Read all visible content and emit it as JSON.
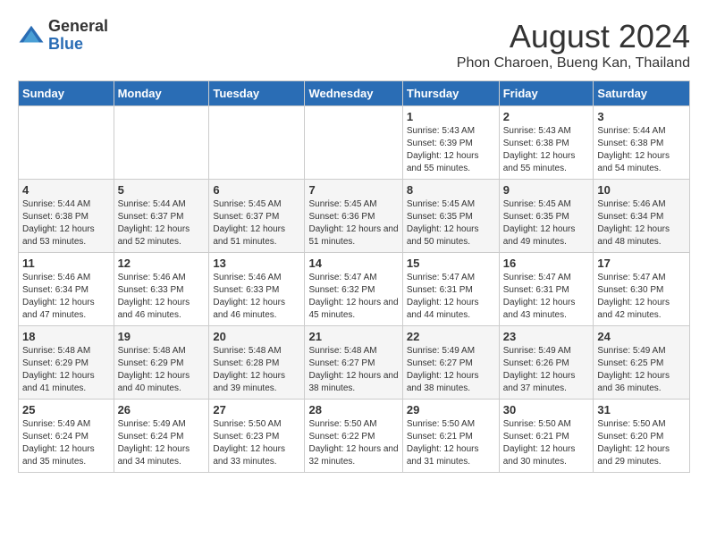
{
  "logo": {
    "general": "General",
    "blue": "Blue"
  },
  "header": {
    "month": "August 2024",
    "location": "Phon Charoen, Bueng Kan, Thailand"
  },
  "days_of_week": [
    "Sunday",
    "Monday",
    "Tuesday",
    "Wednesday",
    "Thursday",
    "Friday",
    "Saturday"
  ],
  "weeks": [
    [
      {
        "day": "",
        "info": ""
      },
      {
        "day": "",
        "info": ""
      },
      {
        "day": "",
        "info": ""
      },
      {
        "day": "",
        "info": ""
      },
      {
        "day": "1",
        "info": "Sunrise: 5:43 AM\nSunset: 6:39 PM\nDaylight: 12 hours and 55 minutes."
      },
      {
        "day": "2",
        "info": "Sunrise: 5:43 AM\nSunset: 6:38 PM\nDaylight: 12 hours and 55 minutes."
      },
      {
        "day": "3",
        "info": "Sunrise: 5:44 AM\nSunset: 6:38 PM\nDaylight: 12 hours and 54 minutes."
      }
    ],
    [
      {
        "day": "4",
        "info": "Sunrise: 5:44 AM\nSunset: 6:38 PM\nDaylight: 12 hours and 53 minutes."
      },
      {
        "day": "5",
        "info": "Sunrise: 5:44 AM\nSunset: 6:37 PM\nDaylight: 12 hours and 52 minutes."
      },
      {
        "day": "6",
        "info": "Sunrise: 5:45 AM\nSunset: 6:37 PM\nDaylight: 12 hours and 51 minutes."
      },
      {
        "day": "7",
        "info": "Sunrise: 5:45 AM\nSunset: 6:36 PM\nDaylight: 12 hours and 51 minutes."
      },
      {
        "day": "8",
        "info": "Sunrise: 5:45 AM\nSunset: 6:35 PM\nDaylight: 12 hours and 50 minutes."
      },
      {
        "day": "9",
        "info": "Sunrise: 5:45 AM\nSunset: 6:35 PM\nDaylight: 12 hours and 49 minutes."
      },
      {
        "day": "10",
        "info": "Sunrise: 5:46 AM\nSunset: 6:34 PM\nDaylight: 12 hours and 48 minutes."
      }
    ],
    [
      {
        "day": "11",
        "info": "Sunrise: 5:46 AM\nSunset: 6:34 PM\nDaylight: 12 hours and 47 minutes."
      },
      {
        "day": "12",
        "info": "Sunrise: 5:46 AM\nSunset: 6:33 PM\nDaylight: 12 hours and 46 minutes."
      },
      {
        "day": "13",
        "info": "Sunrise: 5:46 AM\nSunset: 6:33 PM\nDaylight: 12 hours and 46 minutes."
      },
      {
        "day": "14",
        "info": "Sunrise: 5:47 AM\nSunset: 6:32 PM\nDaylight: 12 hours and 45 minutes."
      },
      {
        "day": "15",
        "info": "Sunrise: 5:47 AM\nSunset: 6:31 PM\nDaylight: 12 hours and 44 minutes."
      },
      {
        "day": "16",
        "info": "Sunrise: 5:47 AM\nSunset: 6:31 PM\nDaylight: 12 hours and 43 minutes."
      },
      {
        "day": "17",
        "info": "Sunrise: 5:47 AM\nSunset: 6:30 PM\nDaylight: 12 hours and 42 minutes."
      }
    ],
    [
      {
        "day": "18",
        "info": "Sunrise: 5:48 AM\nSunset: 6:29 PM\nDaylight: 12 hours and 41 minutes."
      },
      {
        "day": "19",
        "info": "Sunrise: 5:48 AM\nSunset: 6:29 PM\nDaylight: 12 hours and 40 minutes."
      },
      {
        "day": "20",
        "info": "Sunrise: 5:48 AM\nSunset: 6:28 PM\nDaylight: 12 hours and 39 minutes."
      },
      {
        "day": "21",
        "info": "Sunrise: 5:48 AM\nSunset: 6:27 PM\nDaylight: 12 hours and 38 minutes."
      },
      {
        "day": "22",
        "info": "Sunrise: 5:49 AM\nSunset: 6:27 PM\nDaylight: 12 hours and 38 minutes."
      },
      {
        "day": "23",
        "info": "Sunrise: 5:49 AM\nSunset: 6:26 PM\nDaylight: 12 hours and 37 minutes."
      },
      {
        "day": "24",
        "info": "Sunrise: 5:49 AM\nSunset: 6:25 PM\nDaylight: 12 hours and 36 minutes."
      }
    ],
    [
      {
        "day": "25",
        "info": "Sunrise: 5:49 AM\nSunset: 6:24 PM\nDaylight: 12 hours and 35 minutes."
      },
      {
        "day": "26",
        "info": "Sunrise: 5:49 AM\nSunset: 6:24 PM\nDaylight: 12 hours and 34 minutes."
      },
      {
        "day": "27",
        "info": "Sunrise: 5:50 AM\nSunset: 6:23 PM\nDaylight: 12 hours and 33 minutes."
      },
      {
        "day": "28",
        "info": "Sunrise: 5:50 AM\nSunset: 6:22 PM\nDaylight: 12 hours and 32 minutes."
      },
      {
        "day": "29",
        "info": "Sunrise: 5:50 AM\nSunset: 6:21 PM\nDaylight: 12 hours and 31 minutes."
      },
      {
        "day": "30",
        "info": "Sunrise: 5:50 AM\nSunset: 6:21 PM\nDaylight: 12 hours and 30 minutes."
      },
      {
        "day": "31",
        "info": "Sunrise: 5:50 AM\nSunset: 6:20 PM\nDaylight: 12 hours and 29 minutes."
      }
    ]
  ]
}
